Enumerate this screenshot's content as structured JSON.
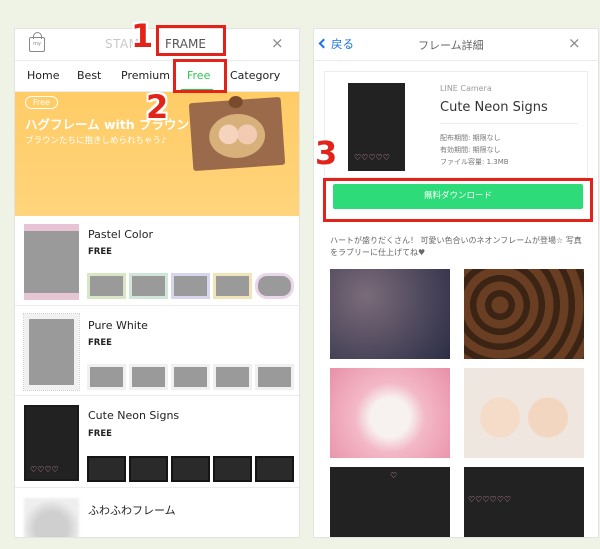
{
  "left": {
    "header": {
      "bag_label": "my",
      "stamp_label": "STAMP",
      "frame_label": "FRAME",
      "close": "×"
    },
    "tabs": [
      {
        "label": "Home"
      },
      {
        "label": "Best"
      },
      {
        "label": "Premium"
      },
      {
        "label": "Free",
        "active": true
      },
      {
        "label": "Category"
      }
    ],
    "banner": {
      "pill": "Free",
      "title": "ハグフレーム with ブラウン",
      "subtitle": "ブラウンたちに抱きしめられちゃう♪"
    },
    "items": [
      {
        "title": "Pastel Color",
        "price": "FREE"
      },
      {
        "title": "Pure White",
        "price": "FREE"
      },
      {
        "title": "Cute Neon Signs",
        "price": "FREE"
      },
      {
        "title": "ふわふわフレーム",
        "price": ""
      }
    ]
  },
  "right": {
    "header": {
      "back": "戻る",
      "title": "フレーム詳細",
      "close": "×"
    },
    "detail": {
      "app": "LINE Camera",
      "name": "Cute Neon Signs",
      "period": "配布期間: 期限なし",
      "validity": "有効期間: 期限なし",
      "size": "ファイル容量: 1.3MB"
    },
    "download": "無料ダウンロード",
    "description": "ハートが盛りだくさん！ 可愛い色合いのネオンフレームが登場☆ 写真をラブリーに仕上げてね♥"
  },
  "annotations": {
    "n1": "1",
    "n2": "2",
    "n3": "3"
  },
  "colors": {
    "accent_green": "#2fc551",
    "download_green": "#2ddc78",
    "highlight_red": "#e2231a",
    "banner_yellow": "#ffcc66"
  }
}
